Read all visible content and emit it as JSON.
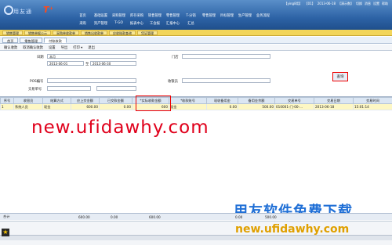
{
  "header": {
    "logo_text": "用友通",
    "logo_mark": "T⁺",
    "status": [
      "【ying8用】",
      "【01】",
      "2013-06-18",
      "【演示数】",
      "切换",
      "消息",
      "设置",
      "帮助"
    ],
    "menu_row1": [
      "首页",
      "基础设置",
      "采购管理",
      "库存采购",
      "销售管理",
      "零售管理",
      "T-分销",
      "零售管理",
      "目标管理",
      "生产管理",
      "业务流程"
    ],
    "menu_row2": [
      "采购",
      "资产管理",
      "T-GO",
      "报表中心",
      "工会报",
      "汇报中心",
      "汇总"
    ]
  },
  "open_tabs": [
    "销售管理",
    "销售单据公示",
    "采购单收款单",
    "销售出收款单",
    "应收账款查询",
    "凭证管理"
  ],
  "sub_tabs": [
    "首页",
    "零售管理",
    "付账收款"
  ],
  "toolbar": [
    "确认收款",
    "取消确认收款",
    "设置",
    "导出",
    "打印 ▾",
    "退出"
  ],
  "filter": {
    "date_label": "日期",
    "date_period": "本月",
    "date_from": "2013-06-01",
    "date_sep": "至",
    "date_to": "2013-06-30",
    "store_label": "门店",
    "pos_label": "POS编号",
    "cashier_label": "收银员",
    "trade_no_label": "交易单号",
    "query_button": "查询"
  },
  "table": {
    "headers": [
      "序号",
      "收银员",
      "结算方式",
      "应上交金额",
      "已交款金额",
      "*实际收款金额",
      "*收款账号",
      "现收备用金",
      "备用金余额",
      "交易单号",
      "交易日期",
      "交易时间"
    ],
    "rows": [
      [
        "1",
        "系统人员",
        "现金",
        "600.00",
        "0.00",
        "600",
        "现金",
        "",
        "0.00",
        "500.00",
        "010001-门-00-...",
        "2013-06-18",
        "15:01:14"
      ]
    ]
  },
  "totals": {
    "label": "合计",
    "values": [
      "600.00",
      "0.00",
      "600.00",
      "0.00",
      "500.00"
    ]
  },
  "watermarks": {
    "url_red": "new.ufidawhy.com",
    "brand_cn": "用友软件免费下载",
    "url_orange": "new.ufidawhy.com"
  },
  "colors": {
    "header_blue": "#2d63a6",
    "tab_yellow": "#f2d55a",
    "highlight_red": "#e00000"
  }
}
